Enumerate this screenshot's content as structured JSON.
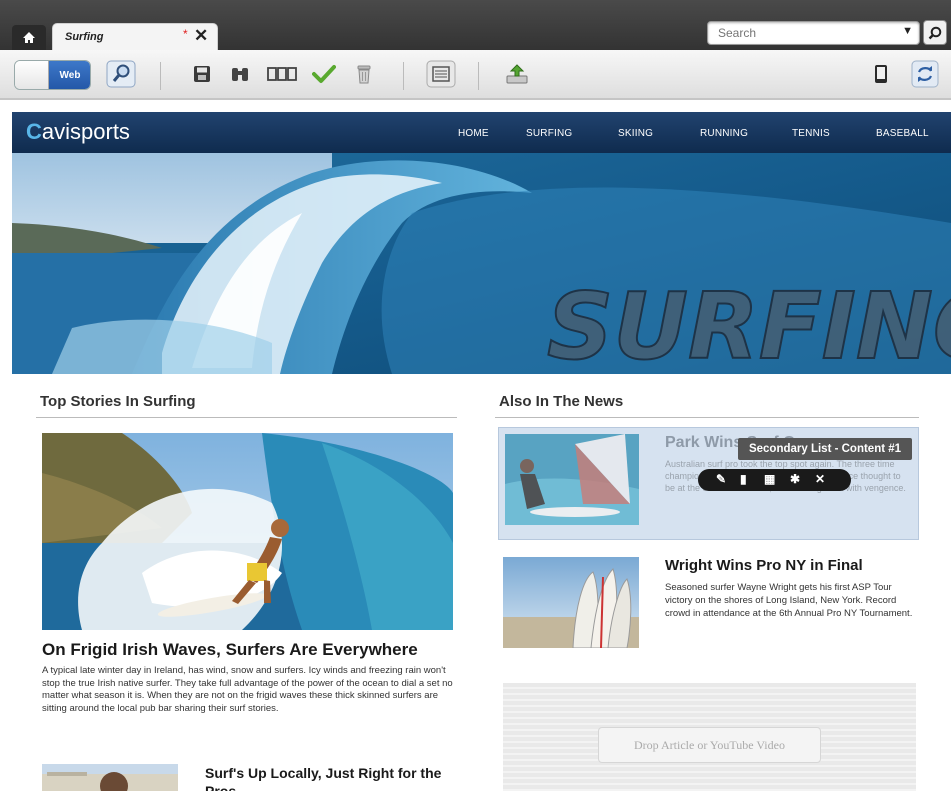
{
  "cms": {
    "home_icon": "home-icon",
    "tab": {
      "title": "Surfing",
      "dirty_marker": "*",
      "close": "✕"
    },
    "search": {
      "placeholder": "Search"
    },
    "toolbar": {
      "mode_label": "Web",
      "icons": [
        "preview-icon",
        "save-icon",
        "find-icon",
        "layout-icon",
        "check-icon",
        "delete-icon",
        "page-icon",
        "publish-icon",
        "device-icon",
        "sync-icon"
      ]
    }
  },
  "site": {
    "logo": {
      "prefix": "avi",
      "suffix": "sports"
    },
    "nav": [
      "HOME",
      "SURFING",
      "SKIING",
      "RUNNING",
      "TENNIS",
      "BASEBALL"
    ],
    "hero_text": "SURFING",
    "top_stories": {
      "heading": "Top Stories In Surfing",
      "feature": {
        "title": "On Frigid Irish Waves, Surfers Are Everywhere",
        "body": "A typical late winter day in Ireland, has wind, snow and surfers. Icy winds and freezing rain won't stop the true Irish native surfer. They take full advantage of the power of the ocean to dial a set no matter what season it is. When they are not on the frigid waves these thick skinned surfers are sitting around the local pub bar sharing their surf stories."
      },
      "second": {
        "title": "Surf's Up Locally, Just Right for the Pros"
      }
    },
    "also_news": {
      "heading": "Also In The News",
      "items": [
        {
          "title": "Park Wins Surf Cup",
          "body": "Australian surf pro took the top spot again. The three time champion was congratulated by Joel Park. Once thought to be at the end of his career, he's coming back with vengence."
        },
        {
          "title": "Wright Wins Pro NY in Final",
          "body": "Seasoned surfer Wayne Wright gets his first ASP Tour victory on the shores of Long Island, New York. Record crowd in attendance at the 6th Annual Pro NY Tournament."
        }
      ],
      "tooltip": "Secondary List - Content #1",
      "drop_label": "Drop Article or YouTube Video"
    }
  }
}
